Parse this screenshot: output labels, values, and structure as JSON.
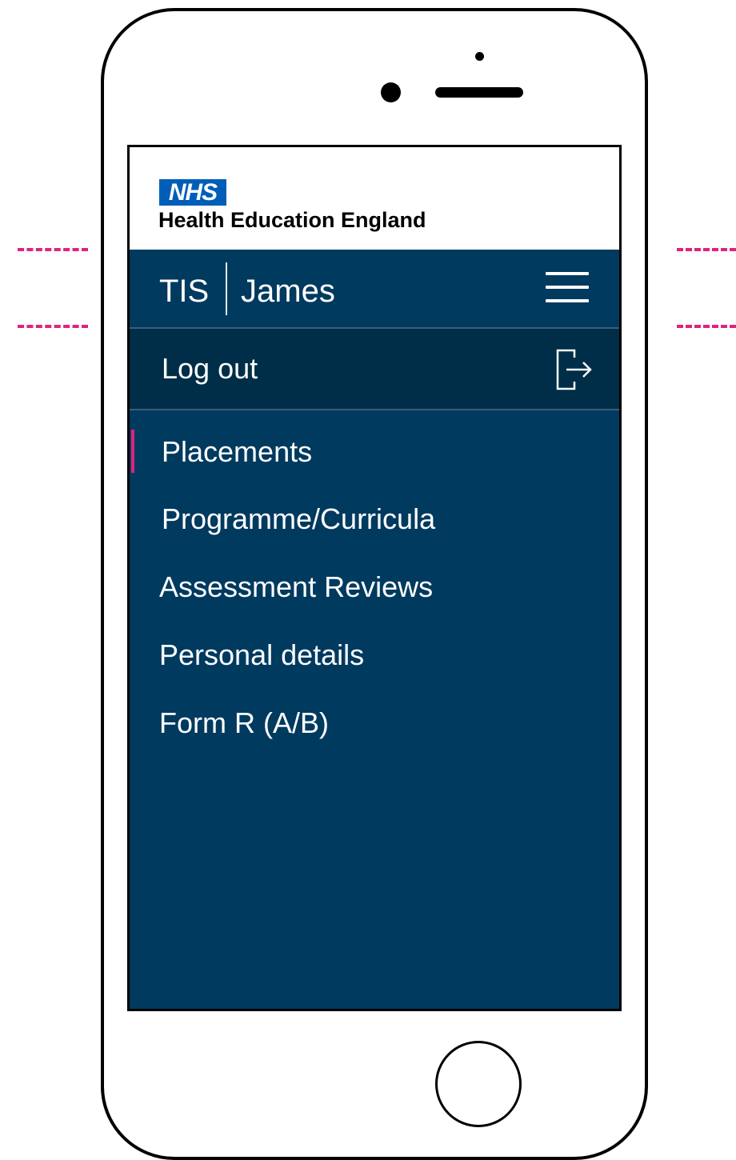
{
  "branding": {
    "nhs_badge": "NHS",
    "organisation": "Health Education England"
  },
  "navbar": {
    "app_name": "TIS",
    "user_name": "James",
    "menu_icon": "hamburger-menu-icon"
  },
  "logout": {
    "label": "Log out",
    "icon": "logout-icon"
  },
  "menu": {
    "items": [
      {
        "label": "Placements",
        "active": true
      },
      {
        "label": "Programme/Curricula",
        "active": false
      },
      {
        "label": "Assessment Reviews",
        "active": false
      },
      {
        "label": "Personal details",
        "active": false
      },
      {
        "label": "Form R (A/B)",
        "active": false
      }
    ]
  },
  "colors": {
    "nav_background": "#003a5f",
    "logout_background": "#002d47",
    "nhs_blue": "#005eb8",
    "active_indicator": "#e0237a",
    "guide_lines": "#e0237a"
  }
}
